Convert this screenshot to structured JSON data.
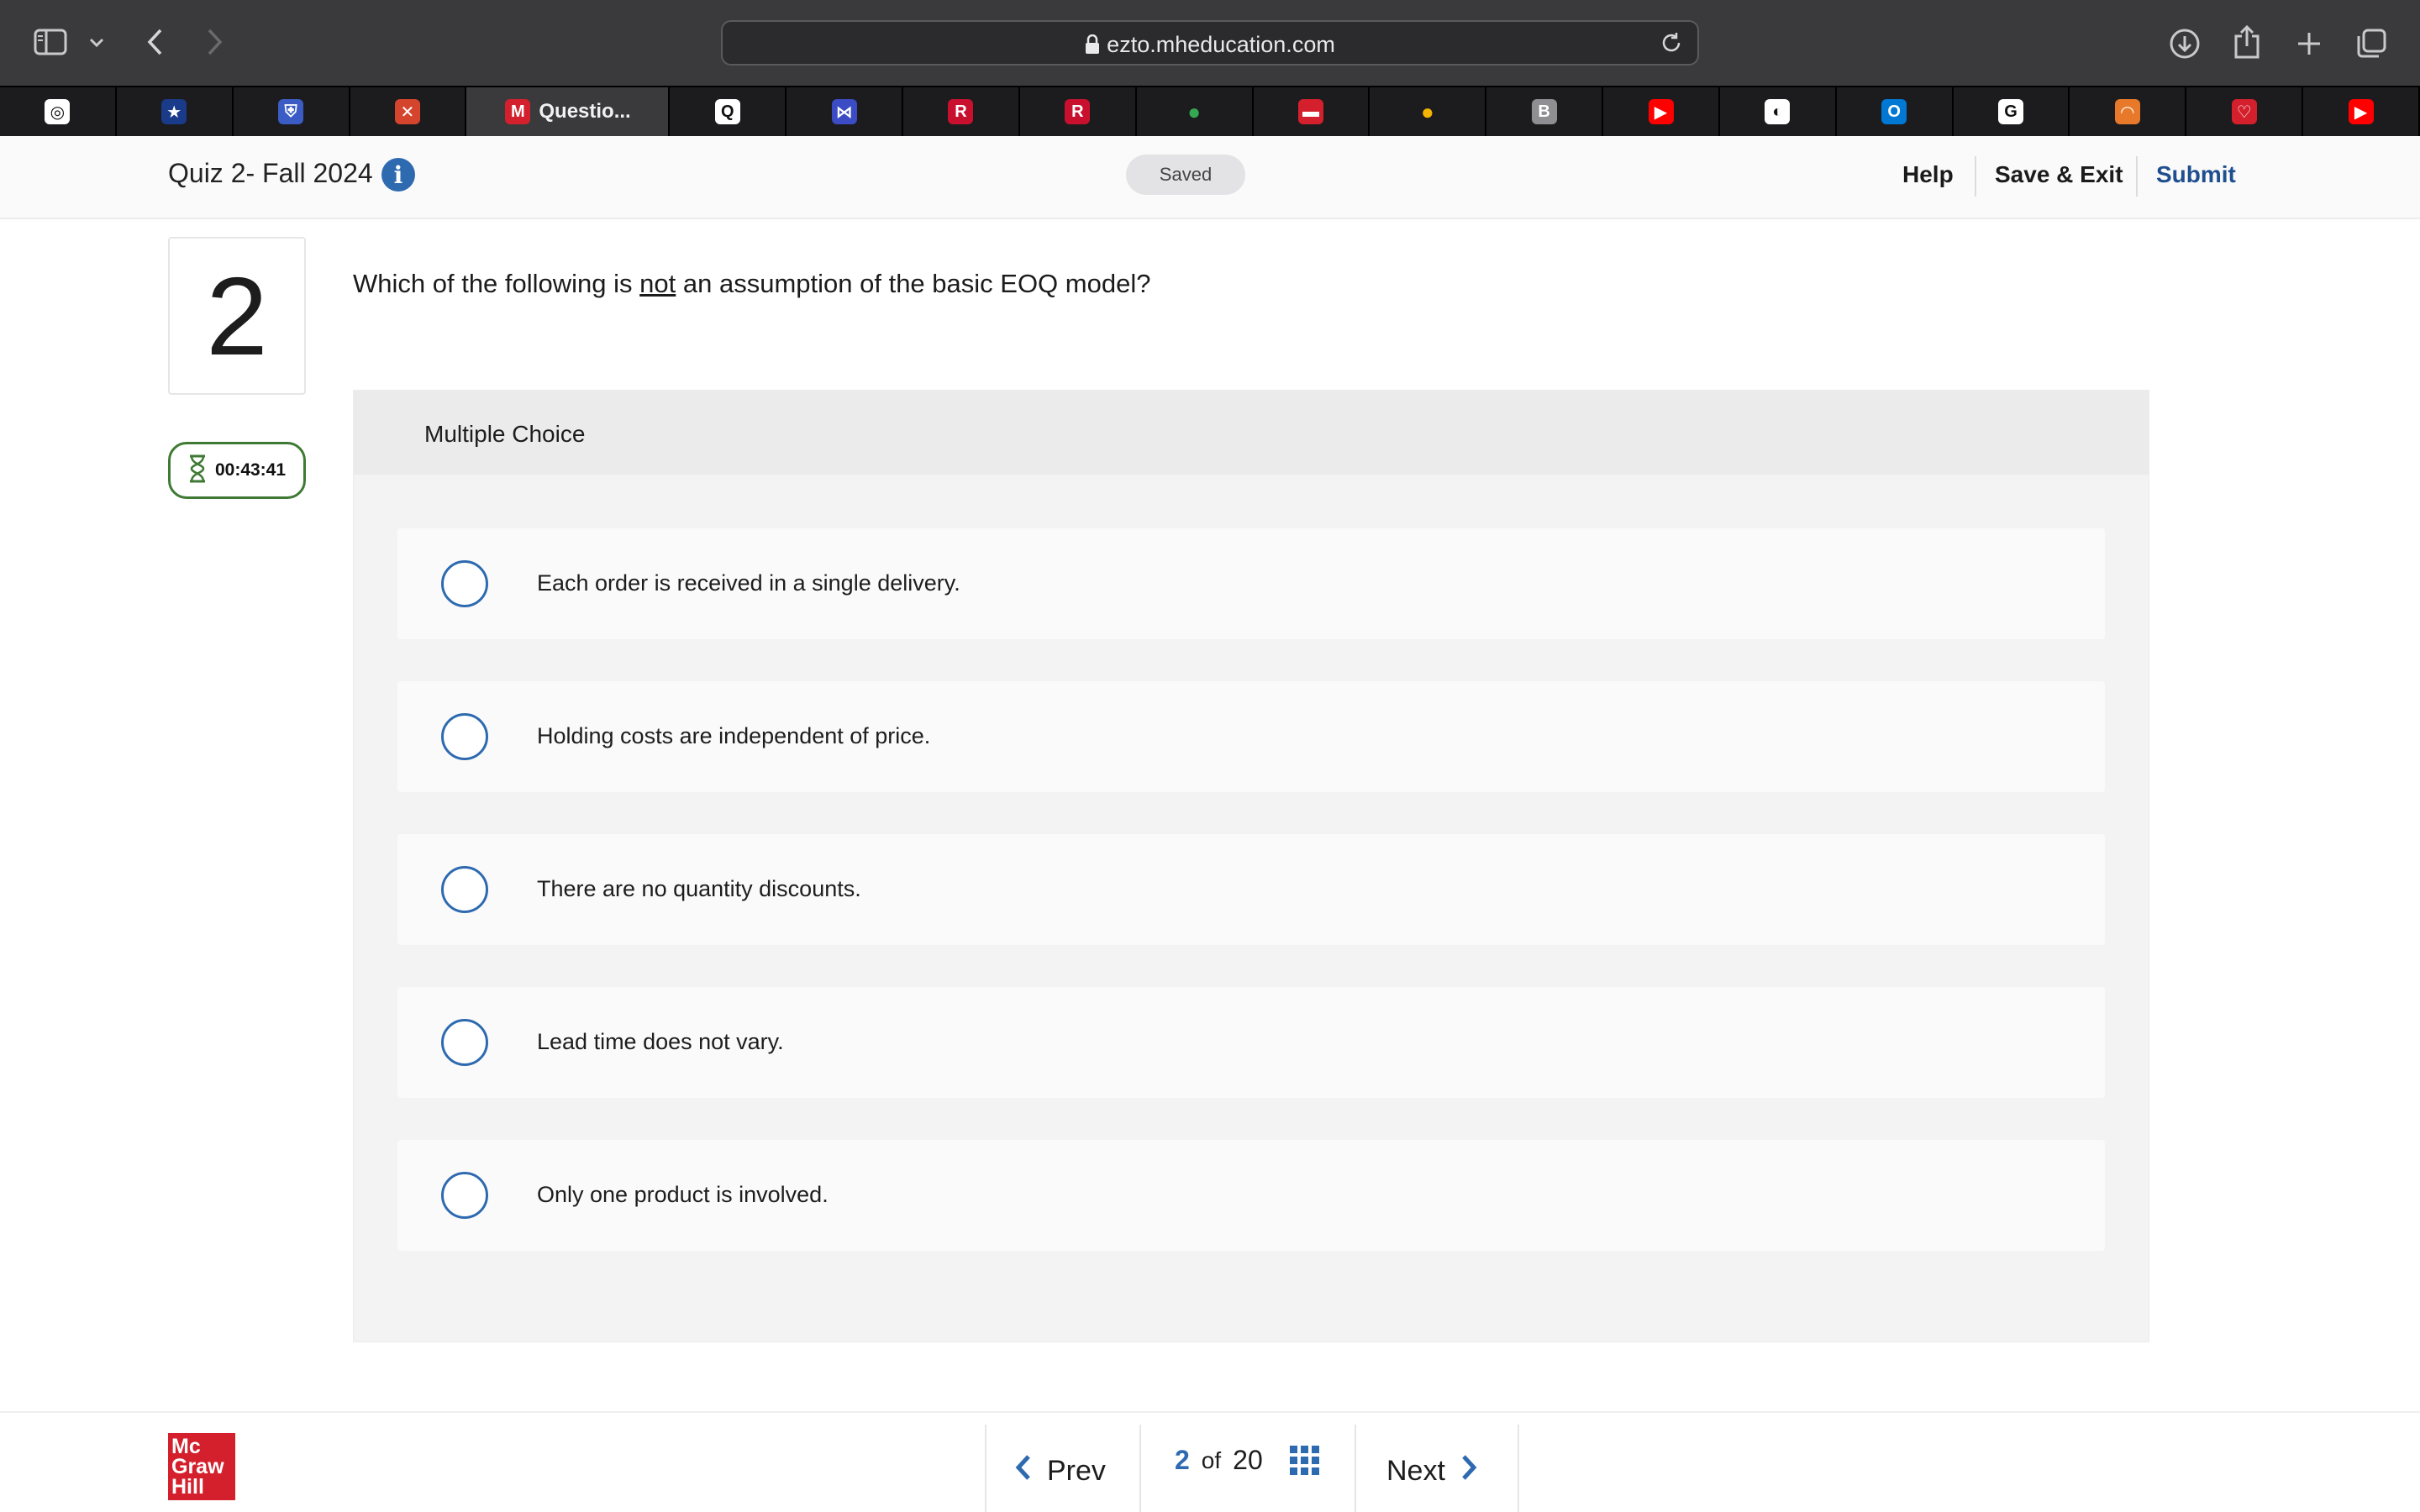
{
  "browser": {
    "url": "ezto.mheducation.com",
    "active_tab_title": "Questio...",
    "tabs": [
      {
        "icon": "openai-icon",
        "color": "#ffffff",
        "glyph": "◎"
      },
      {
        "icon": "star-badge-icon",
        "color": "#1a3a8a",
        "glyph": "★"
      },
      {
        "icon": "shield-icon",
        "color": "#3b5cc4",
        "glyph": "⛨"
      },
      {
        "icon": "compass-icon",
        "color": "#d5442c",
        "glyph": "✕"
      },
      {
        "icon": "mcgraw-m-icon",
        "color": "#d4202c",
        "glyph": "M",
        "active": true
      },
      {
        "icon": "q-badge-icon",
        "color": "#ffffff",
        "glyph": "Q"
      },
      {
        "icon": "bowtie-icon",
        "color": "#3b4cc4",
        "glyph": "⋈"
      },
      {
        "icon": "r-logo-icon",
        "color": "#c8102e",
        "glyph": "R"
      },
      {
        "icon": "r-logo-icon",
        "color": "#c8102e",
        "glyph": "R"
      },
      {
        "icon": "maps-pin-icon",
        "color": "#34a853",
        "glyph": "●"
      },
      {
        "icon": "pill-icon",
        "color": "#d4202c",
        "glyph": "▬"
      },
      {
        "icon": "location-pin-icon",
        "color": "#f4b400",
        "glyph": "●"
      },
      {
        "icon": "b-badge-icon",
        "color": "#8e8e93",
        "glyph": "B"
      },
      {
        "icon": "youtube-icon",
        "color": "#ff0000",
        "glyph": "▶"
      },
      {
        "icon": "dark-circle-icon",
        "color": "#ffffff",
        "glyph": "◐"
      },
      {
        "icon": "outlook-icon",
        "color": "#0078d4",
        "glyph": "O"
      },
      {
        "icon": "google-icon",
        "color": "#ffffff",
        "glyph": "G"
      },
      {
        "icon": "headphones-icon",
        "color": "#e8792b",
        "glyph": "◠"
      },
      {
        "icon": "red-shield-icon",
        "color": "#d4202c",
        "glyph": "♡"
      },
      {
        "icon": "youtube-icon",
        "color": "#ff0000",
        "glyph": "▶"
      }
    ]
  },
  "header": {
    "quiz_title": "Quiz 2- Fall 2024",
    "saved_label": "Saved",
    "help_label": "Help",
    "save_exit_label": "Save & Exit",
    "submit_label": "Submit",
    "accent_color": "#2e6ab0"
  },
  "question": {
    "number": "2",
    "timer": "00:43:41",
    "text_before": "Which of the following is ",
    "text_emphasis": "not",
    "text_after": " an assumption of the basic EOQ model?",
    "type_label": "Multiple Choice",
    "options": [
      "Each order is received in a single delivery.",
      "Holding costs are independent of price.",
      "There are no quantity discounts.",
      "Lead time does not vary.",
      "Only one product is involved."
    ]
  },
  "footer": {
    "logo_lines": [
      "Mc",
      "Graw",
      "Hill"
    ],
    "prev_label": "Prev",
    "next_label": "Next",
    "current_page": "2",
    "of_label": "of",
    "total_pages": "20"
  }
}
